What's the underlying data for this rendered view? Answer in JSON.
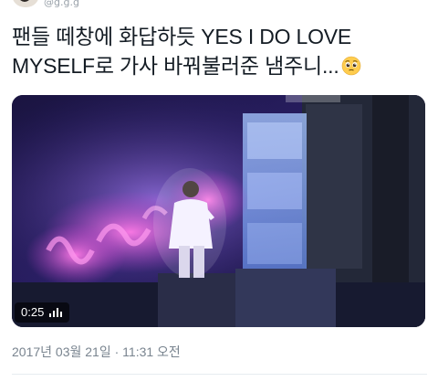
{
  "tweet": {
    "text_line1": "팬들 떼창에 화답하듯 YES I DO LOVE",
    "text_line2": "MYSELF로 가사 바꿔불러준 냄주니...",
    "emoji_icon": "pleading-face-emoji"
  },
  "media": {
    "duration": "0:25",
    "volume_icon": "volume-bars-icon"
  },
  "timestamp": {
    "date": "2017년 03월 21일",
    "separator": " · ",
    "time": "11:31 오전"
  },
  "colors": {
    "text": "#141c24",
    "meta": "#79848f",
    "divider": "#e6ecf0"
  }
}
